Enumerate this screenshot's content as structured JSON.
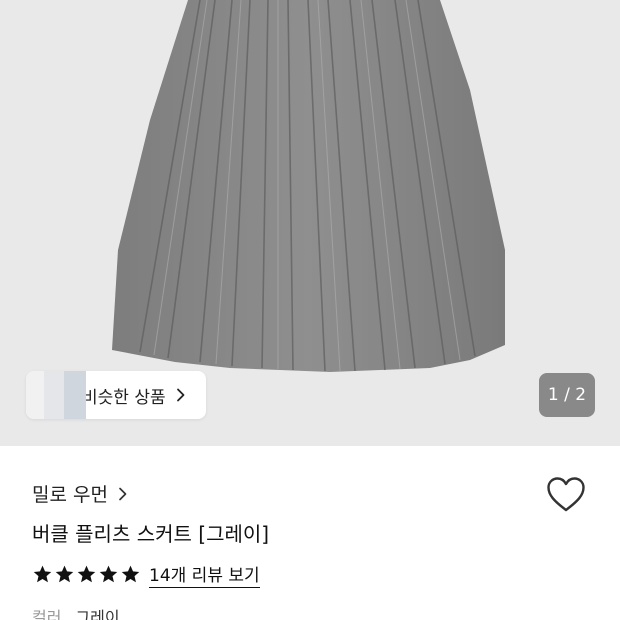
{
  "gallery": {
    "similar_button_label": "비슷한 상품",
    "pager": "1 / 2"
  },
  "product": {
    "brand": "밀로 우먼",
    "title": "버클 플리츠 스커트 [그레이]",
    "rating_stars": 5,
    "review_link": "14개 리뷰 보기",
    "option_label": "컬러",
    "option_value": "그레이"
  },
  "icons": {
    "brand_chevron": "chevron-right-icon",
    "similar_chevron": "chevron-right-icon",
    "wishlist": "heart-outline-icon",
    "star": "star-filled-icon"
  },
  "colors": {
    "hero_background": "#e9e9e9",
    "skirt": "#8a8a8a",
    "star": "#111111"
  }
}
